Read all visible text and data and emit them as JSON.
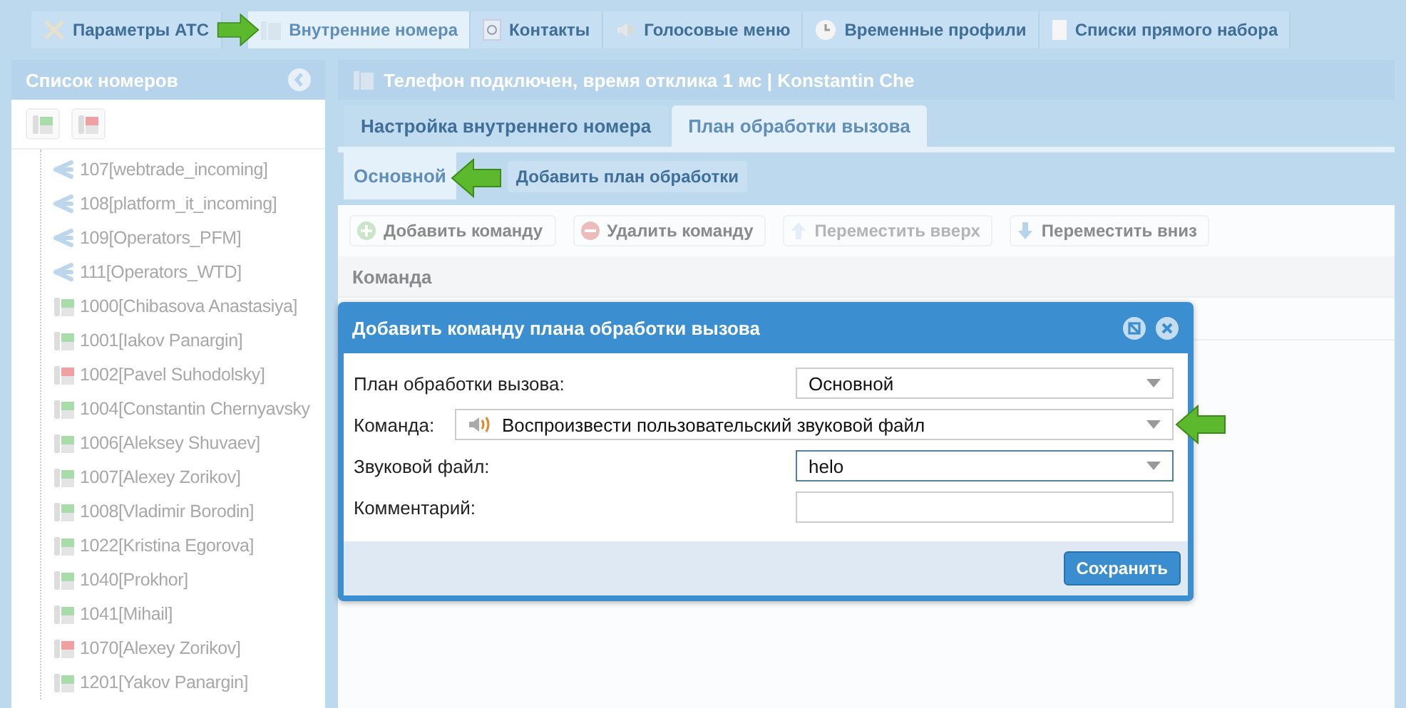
{
  "main_tabs": [
    {
      "label": "Параметры АТС",
      "selected": false
    },
    {
      "label": "Внутренние номера",
      "selected": true
    },
    {
      "label": "Контакты",
      "selected": false
    },
    {
      "label": "Голосовые меню",
      "selected": false
    },
    {
      "label": "Временные профили",
      "selected": false
    },
    {
      "label": "Списки прямого набора",
      "selected": false
    }
  ],
  "sidebar": {
    "title": "Список номеров",
    "items": [
      {
        "label": "107[webtrade_incoming]",
        "kind": "group"
      },
      {
        "label": "108[platform_it_incoming]",
        "kind": "group"
      },
      {
        "label": "109[Operators_PFM]",
        "kind": "group"
      },
      {
        "label": "111[Operators_WTD]",
        "kind": "group"
      },
      {
        "label": "1000[Chibasova Anastasiya]",
        "kind": "phone",
        "color": "#a8dca8"
      },
      {
        "label": "1001[Iakov Panargin]",
        "kind": "phone",
        "color": "#a8dca8"
      },
      {
        "label": "1002[Pavel Suhodolsky]",
        "kind": "phone",
        "color": "#f0a0a0"
      },
      {
        "label": "1004[Constantin Chernyavsky",
        "kind": "phone",
        "color": "#a8dca8"
      },
      {
        "label": "1006[Aleksey Shuvaev]",
        "kind": "phone",
        "color": "#a8dca8"
      },
      {
        "label": "1007[Alexey Zorikov]",
        "kind": "phone",
        "color": "#a8dca8"
      },
      {
        "label": "1008[Vladimir Borodin]",
        "kind": "phone",
        "color": "#a8dca8"
      },
      {
        "label": "1022[Kristina Egorova]",
        "kind": "phone",
        "color": "#a8dca8"
      },
      {
        "label": "1040[Prokhor]",
        "kind": "phone",
        "color": "#a8dca8"
      },
      {
        "label": "1041[Mihail]",
        "kind": "phone",
        "color": "#a8dca8"
      },
      {
        "label": "1070[Alexey Zorikov]",
        "kind": "phone",
        "color": "#f0a0a0"
      },
      {
        "label": "1201[Yakov Panargin]",
        "kind": "phone",
        "color": "#a8dca8"
      }
    ]
  },
  "panel": {
    "title": "Телефон подключен, время отклика 1 мс | Konstantin Che",
    "tabs": [
      {
        "label": "Настройка внутреннего номера",
        "selected": false
      },
      {
        "label": "План обработки вызова",
        "selected": true
      }
    ],
    "plans": [
      {
        "label": "Основной",
        "selected": true
      }
    ],
    "add_plan_button": "Добавить план обработки",
    "toolbar": [
      {
        "label": "Добавить команду",
        "disabled": false
      },
      {
        "label": "Удалить команду",
        "disabled": false
      },
      {
        "label": "Переместить вверх",
        "disabled": true
      },
      {
        "label": "Переместить вниз",
        "disabled": false
      }
    ],
    "table": {
      "columns": [
        "Команда"
      ]
    }
  },
  "dialog": {
    "title": "Добавить команду плана обработки вызова",
    "fields": [
      {
        "label": "План обработки вызова:",
        "kind": "select",
        "value": "Основной",
        "focused": false
      },
      {
        "label": "Команда:",
        "kind": "command",
        "value": "Воспроизвести пользовательский звуковой файл",
        "focused": false
      },
      {
        "label": "Звуковой файл:",
        "kind": "select",
        "value": "helo",
        "focused": true
      },
      {
        "label": "Комментарий:",
        "kind": "text",
        "focused": false
      }
    ],
    "save_button": "Сохранить"
  }
}
